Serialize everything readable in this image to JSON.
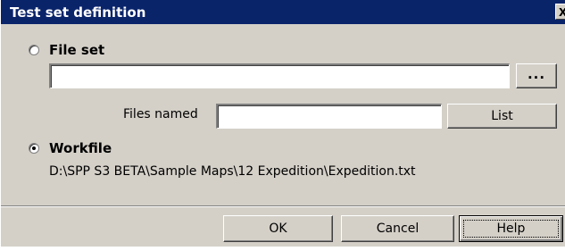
{
  "window": {
    "title": "Test set definition",
    "close_glyph": "X"
  },
  "file_set": {
    "label": "File set",
    "selected": false,
    "path_value": "",
    "browse_label": "...",
    "files_named_label": "Files named",
    "files_named_value": "",
    "list_label": "List"
  },
  "workfile": {
    "label": "Workfile",
    "selected": true,
    "path": "D:\\SPP S3 BETA\\Sample Maps\\12 Expedition\\Expedition.txt"
  },
  "footer": {
    "ok_label": "OK",
    "cancel_label": "Cancel",
    "help_label": "Help"
  },
  "colors": {
    "titlebar": "#0a246a",
    "dialog_face": "#d4d0c8"
  }
}
